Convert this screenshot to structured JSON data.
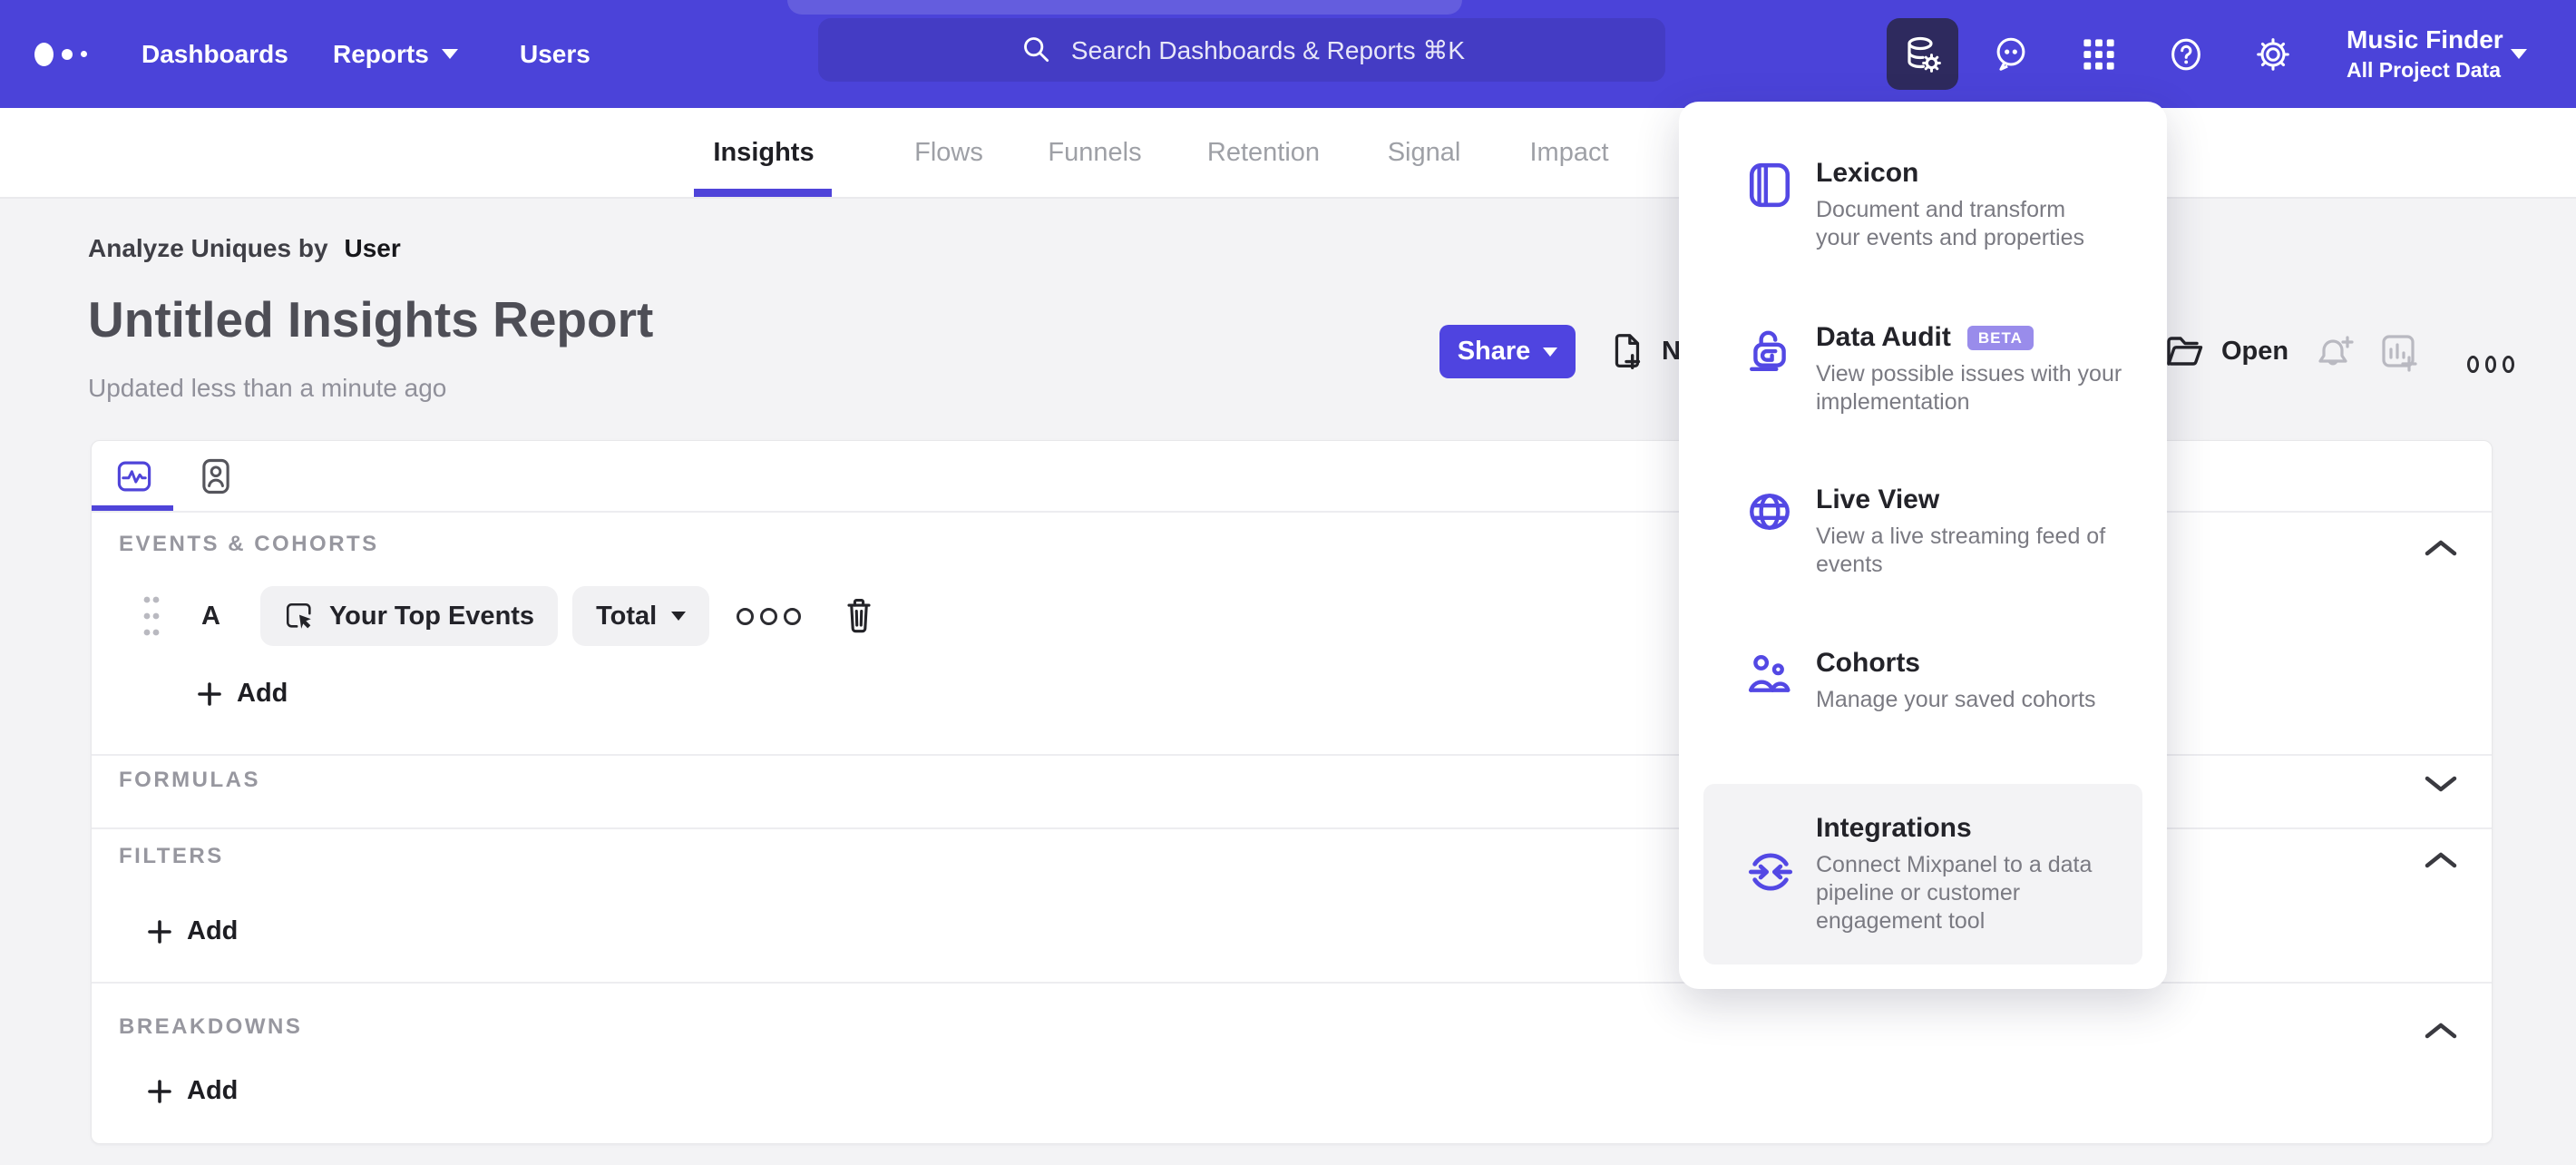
{
  "topnav": {
    "links": [
      {
        "label": "Dashboards"
      },
      {
        "label": "Reports"
      },
      {
        "label": "Users"
      }
    ],
    "search": {
      "placeholder": "Search Dashboards & Reports ⌘K"
    },
    "project": {
      "name": "Music Finder",
      "scope": "All Project Data"
    }
  },
  "tabs": [
    {
      "label": "Insights"
    },
    {
      "label": "Flows"
    },
    {
      "label": "Funnels"
    },
    {
      "label": "Retention"
    },
    {
      "label": "Signal"
    },
    {
      "label": "Impact"
    }
  ],
  "report": {
    "analyze_prefix": "Analyze Uniques by",
    "analyze_value": "User",
    "title": "Untitled Insights Report",
    "updated": "Updated less than a minute ago",
    "actions": {
      "share": "Share",
      "new": "New",
      "open": "Open"
    }
  },
  "query": {
    "sections": {
      "events": "EVENTS & COHORTS",
      "formulas": "FORMULAS",
      "filters": "FILTERS",
      "breakdowns": "BREAKDOWNS"
    },
    "event_row": {
      "letter": "A",
      "event": "Your Top Events",
      "metric": "Total"
    },
    "add_label": "Add"
  },
  "menu": {
    "items": [
      {
        "title": "Lexicon",
        "line1": "Document and transform",
        "line2": "your events and properties"
      },
      {
        "title": "Data Audit",
        "badge": "BETA",
        "line1": "View possible issues with your",
        "line2": "implementation"
      },
      {
        "title": "Live View",
        "line1": "View a live streaming feed of",
        "line2": "events"
      },
      {
        "title": "Cohorts",
        "line1": "Manage your saved cohorts"
      },
      {
        "title": "Integrations",
        "line1": "Connect Mixpanel to a data",
        "line2": "pipeline or customer",
        "line3": "engagement tool"
      }
    ]
  },
  "colors": {
    "nav": "#4B43D9",
    "accent": "#4F44E0",
    "active_icon_bg": "#2E2A5E",
    "badge": "#998CEB",
    "page_bg": "#F3F3F5"
  }
}
